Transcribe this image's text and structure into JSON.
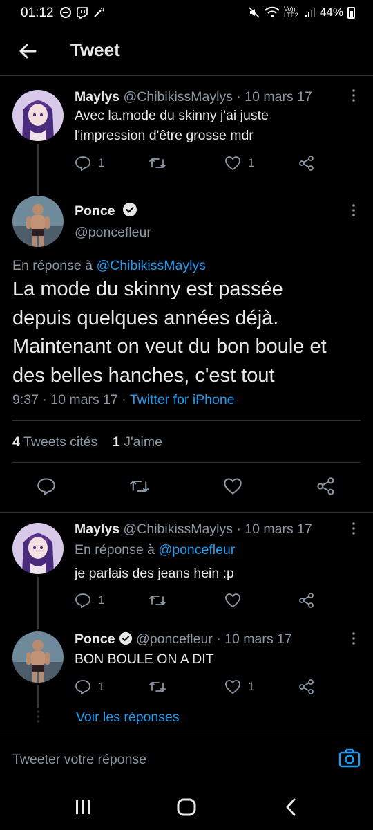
{
  "status_bar": {
    "time": "01:12",
    "net_label": "Vo)) LTE2",
    "battery": "44%"
  },
  "header": {
    "title": "Tweet"
  },
  "tweets": [
    {
      "name": "Maylys",
      "handle": "@ChibikissMaylys",
      "date": "· 10 mars 17",
      "line1": "Avec la.mode du skinny j'ai juste",
      "line2": "l'impression d'être grosse mdr",
      "replies": "1",
      "likes": "1"
    }
  ],
  "main_tweet": {
    "name": "Ponce",
    "handle": "@poncefleur",
    "reply_prefix": "En réponse à",
    "reply_to": "@ChibikissMaylys",
    "lines": [
      "La mode du skinny est passée",
      "depuis quelques années déjà.",
      "Maintenant on veut du bon boule et",
      "des belles hanches, c'est tout"
    ],
    "time_date": "9:37 · 10 mars 17 ·",
    "source": "Twitter for iPhone",
    "quote_count": "4",
    "quote_label": "Tweets cités",
    "like_count": "1",
    "like_label": "J'aime"
  },
  "replies": [
    {
      "name": "Maylys",
      "handle": "@ChibikissMaylys",
      "date": "· 10 mars 17",
      "reply_prefix": "En réponse à",
      "reply_to": "@poncefleur",
      "text": "je parlais des jeans hein :p",
      "replies": "1"
    },
    {
      "name": "Ponce",
      "handle": "@poncefleur",
      "date": "· 10 mars 17",
      "text": "BON BOULE ON A DIT",
      "replies": "1",
      "likes": "1"
    }
  ],
  "see_replies": "Voir les réponses",
  "reply_box": {
    "placeholder": "Tweeter votre réponse"
  },
  "colors": {
    "accent": "#1d9bf0",
    "background": "#000000",
    "muted": "#8b98a5"
  },
  "icons": [
    "back-arrow-icon",
    "reply-icon",
    "retweet-icon",
    "like-icon",
    "share-icon",
    "more-icon",
    "verified-badge-icon",
    "camera-icon",
    "recent-apps-icon",
    "home-icon",
    "back-nav-icon"
  ]
}
